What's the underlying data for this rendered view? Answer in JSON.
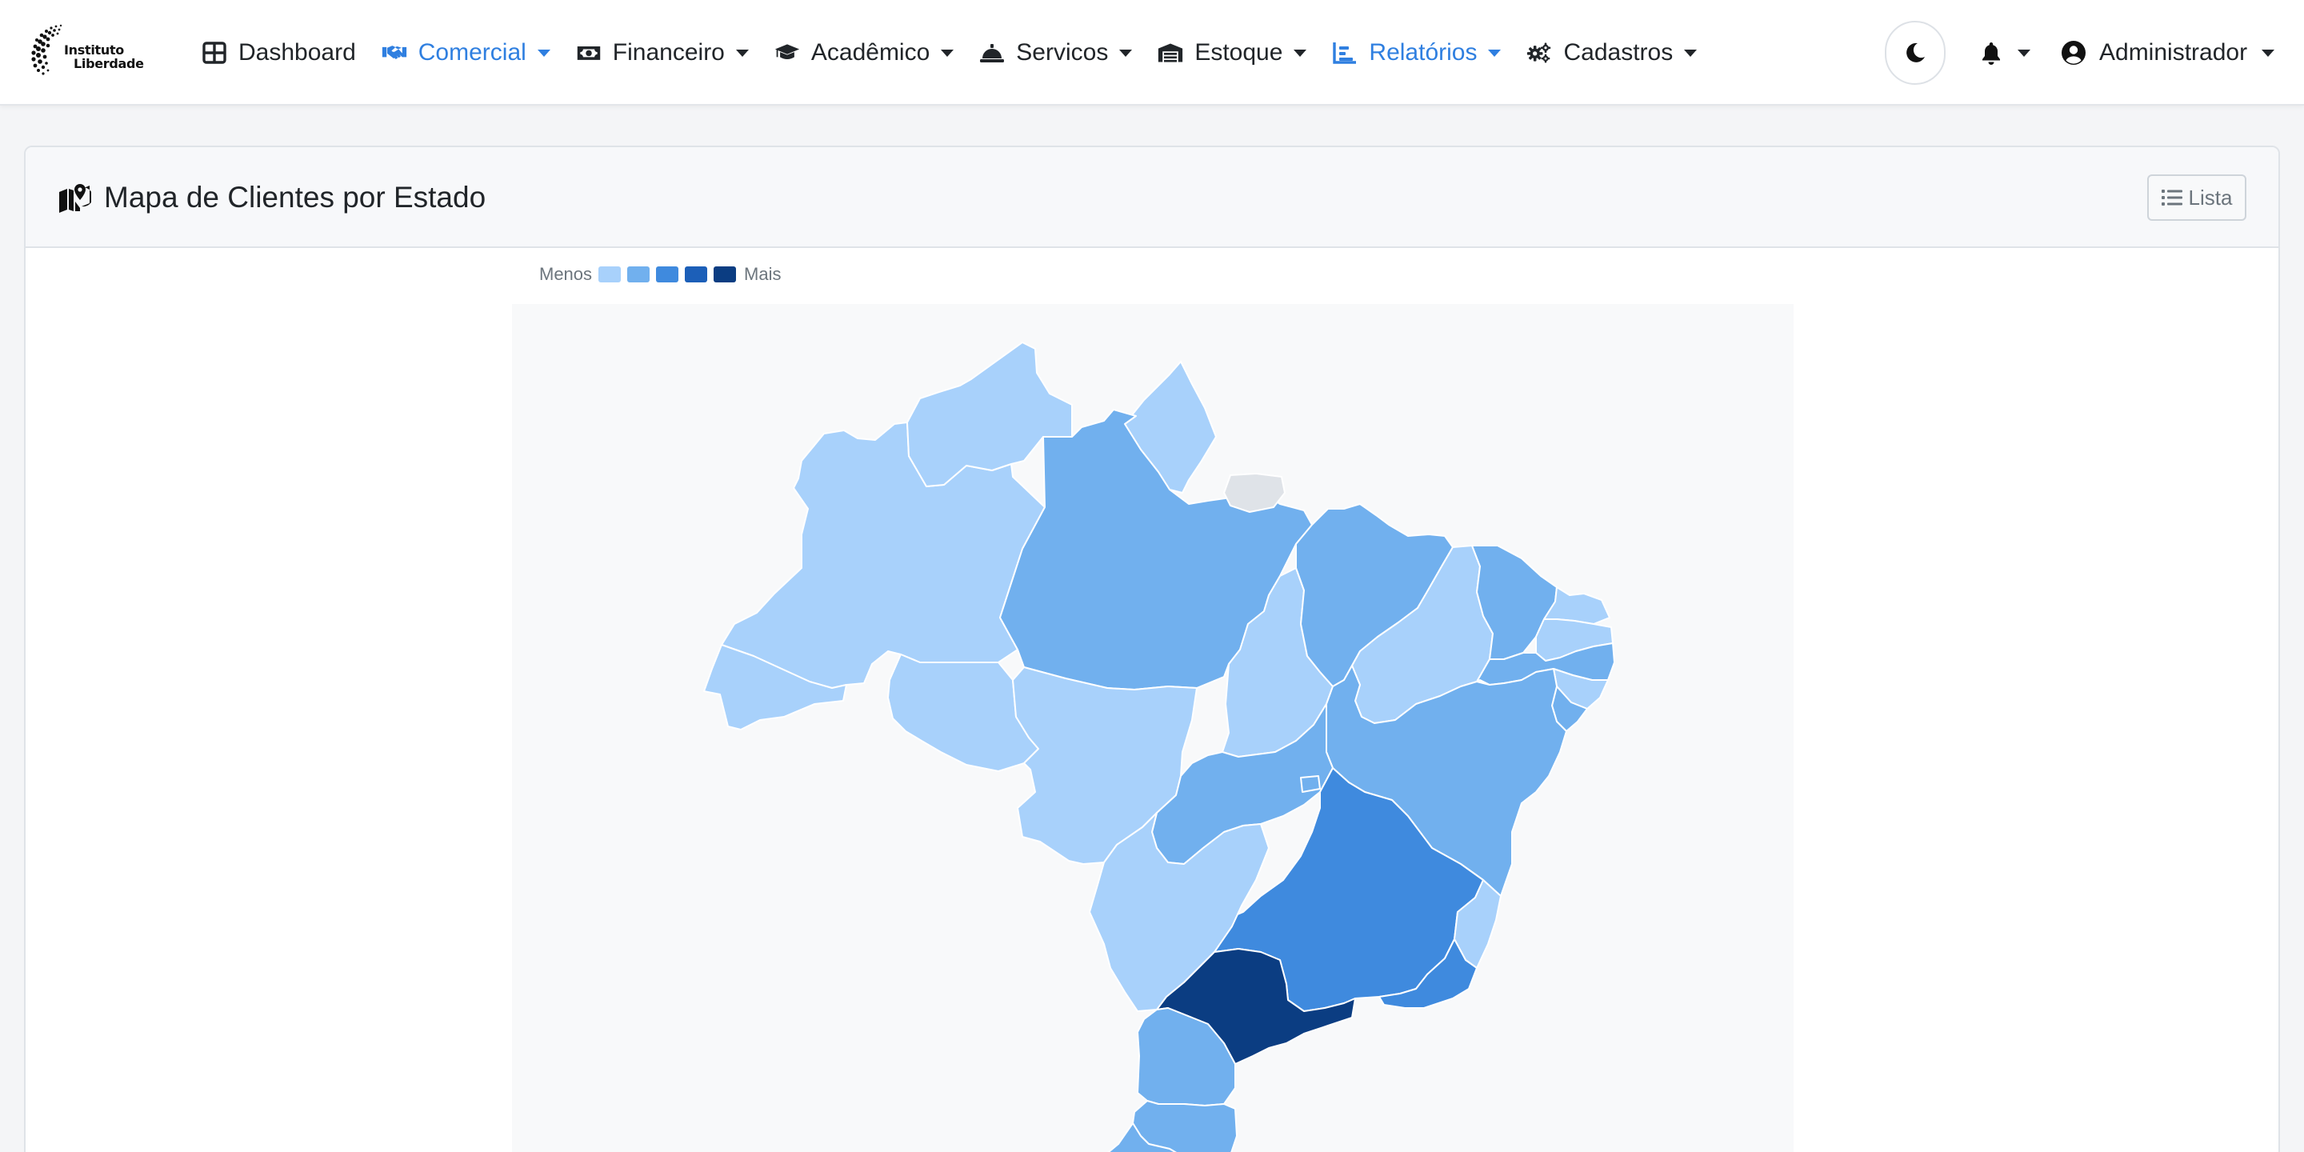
{
  "brand": {
    "line1": "Instituto",
    "line2": "Liberdade"
  },
  "nav": {
    "items": [
      {
        "label": "Dashboard",
        "icon": "table-grid-icon",
        "active": false,
        "dropdown": false
      },
      {
        "label": "Comercial",
        "icon": "handshake-icon",
        "active": true,
        "dropdown": true
      },
      {
        "label": "Financeiro",
        "icon": "money-bill-icon",
        "active": false,
        "dropdown": true
      },
      {
        "label": "Acadêmico",
        "icon": "graduation-cap-icon",
        "active": false,
        "dropdown": true
      },
      {
        "label": "Servicos",
        "icon": "service-bell-icon",
        "active": false,
        "dropdown": true
      },
      {
        "label": "Estoque",
        "icon": "warehouse-icon",
        "active": false,
        "dropdown": true
      },
      {
        "label": "Relatórios",
        "icon": "chart-bar-icon",
        "active": true,
        "dropdown": true
      },
      {
        "label": "Cadastros",
        "icon": "gears-icon",
        "active": false,
        "dropdown": true
      }
    ],
    "user_name": "Administrador"
  },
  "card": {
    "title": "Mapa de Clientes por Estado",
    "list_button_label": "Lista"
  },
  "legend": {
    "min_label": "Menos",
    "max_label": "Mais",
    "colors": [
      "#a8d1fb",
      "#71b0ee",
      "#3f8ade",
      "#1c5fb8",
      "#0b3d82"
    ]
  },
  "colors": {
    "accent": "#2f7fe0",
    "no_data": "#dfe3e8"
  },
  "map": {
    "states": [
      {
        "uf": "RR",
        "level": 1
      },
      {
        "uf": "AP",
        "level": 1
      },
      {
        "uf": "AM",
        "level": 1
      },
      {
        "uf": "PA",
        "level": 2
      },
      {
        "uf": "AC",
        "level": 1
      },
      {
        "uf": "RO",
        "level": 1
      },
      {
        "uf": "MT",
        "level": 1
      },
      {
        "uf": "TO",
        "level": 1
      },
      {
        "uf": "MA",
        "level": 2
      },
      {
        "uf": "PI",
        "level": 1
      },
      {
        "uf": "CE",
        "level": 2
      },
      {
        "uf": "RN",
        "level": 1
      },
      {
        "uf": "PB",
        "level": 1
      },
      {
        "uf": "PE",
        "level": 2
      },
      {
        "uf": "AL",
        "level": 1
      },
      {
        "uf": "SE",
        "level": 2
      },
      {
        "uf": "BA",
        "level": 2
      },
      {
        "uf": "GO",
        "level": 2
      },
      {
        "uf": "DF",
        "level": 2
      },
      {
        "uf": "MG",
        "level": 3
      },
      {
        "uf": "ES",
        "level": 1
      },
      {
        "uf": "RJ",
        "level": 3
      },
      {
        "uf": "MS",
        "level": 1
      },
      {
        "uf": "SP",
        "level": 5
      },
      {
        "uf": "PR",
        "level": 2
      },
      {
        "uf": "SC",
        "level": 2
      },
      {
        "uf": "RS",
        "level": 2
      },
      {
        "uf": "MARAJO",
        "level": 0
      }
    ]
  }
}
